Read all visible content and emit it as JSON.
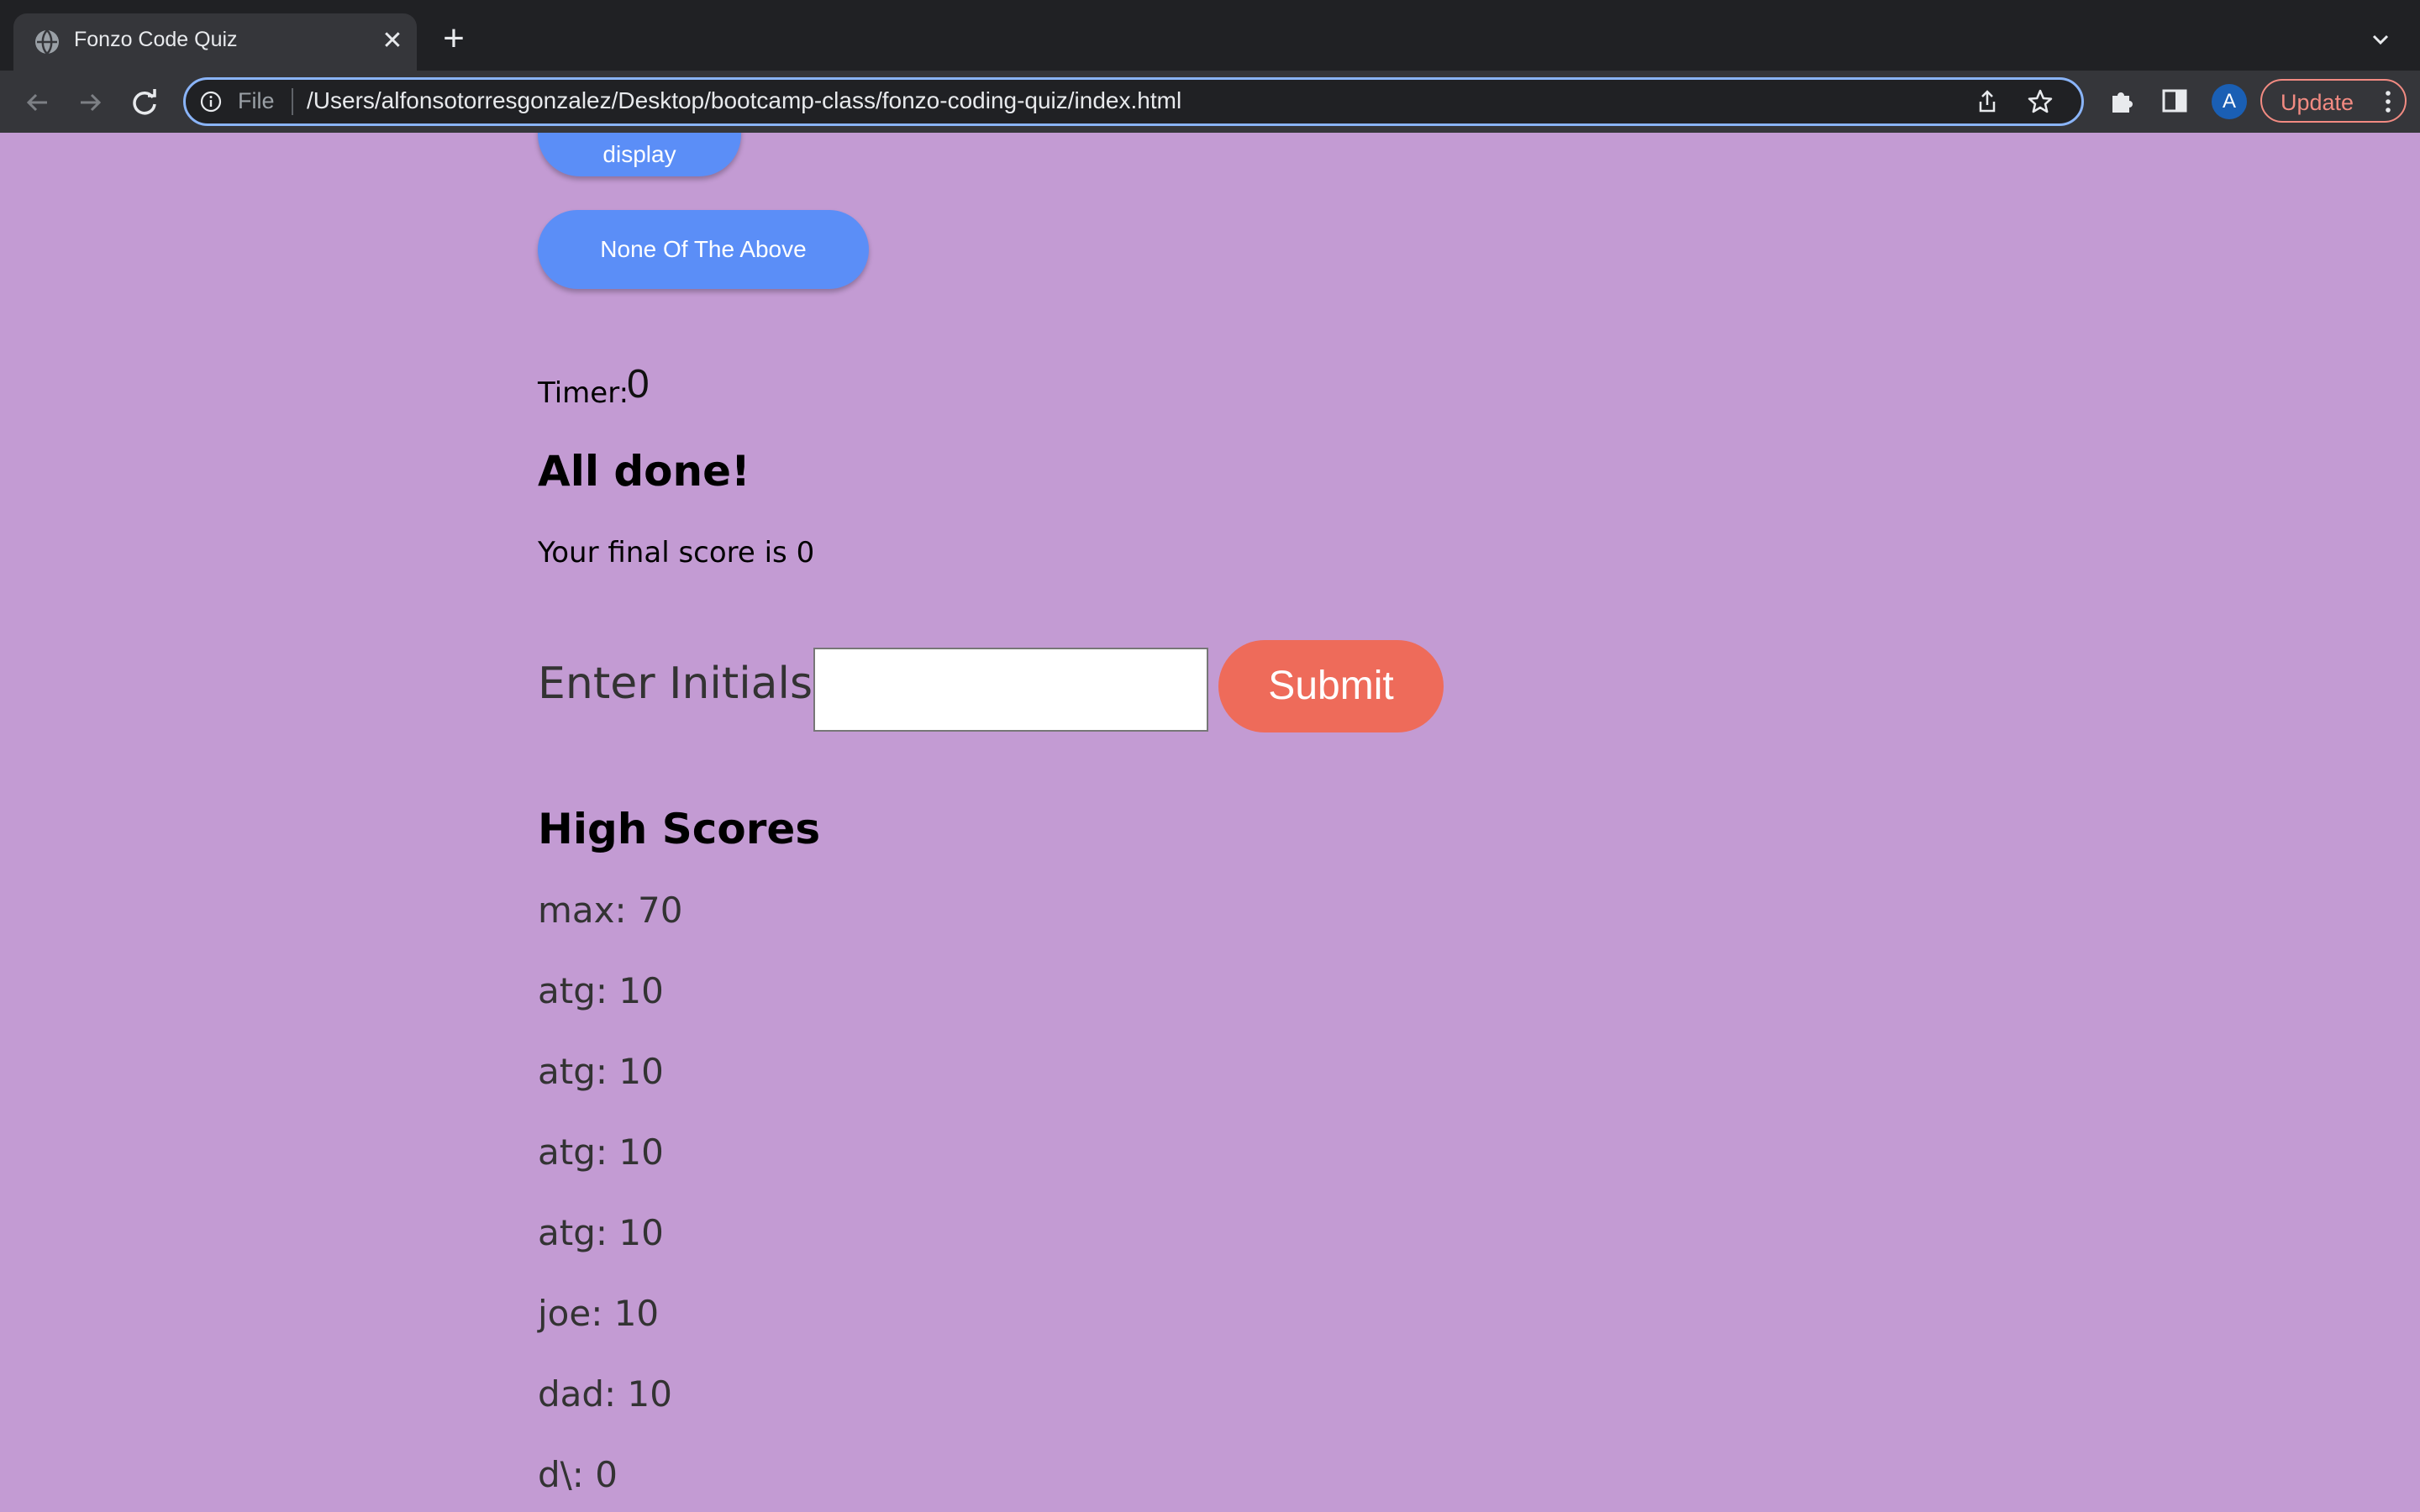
{
  "browser": {
    "tab_title": "Fonzo Code Quiz",
    "omnibox_scheme_label": "File",
    "url": "/Users/alfonsotorresgonzalez/Desktop/bootcamp-class/fonzo-coding-quiz/index.html",
    "avatar_letter": "A",
    "update_label": "Update",
    "icons": [
      "globe-icon",
      "close-icon",
      "plus-icon",
      "chevron-down-icon",
      "back-arrow-icon",
      "forward-arrow-icon",
      "reload-icon",
      "info-icon",
      "share-icon",
      "star-icon",
      "puzzle-icon",
      "side-panel-icon",
      "kebab-menu-icon"
    ]
  },
  "quiz": {
    "answer_partial_label": "display",
    "answer_none_label": "None Of The Above",
    "timer_label": "Timer:",
    "timer_value": "0",
    "done_heading": "All done!",
    "final_score_text": "Your final score is 0",
    "initials_label": "Enter Initials:",
    "initials_value": "",
    "submit_label": "Submit"
  },
  "high_scores": {
    "heading": "High Scores",
    "entries": [
      "max: 70",
      "atg: 10",
      "atg: 10",
      "atg: 10",
      "atg: 10",
      "joe: 10",
      "dad: 10",
      "d\\: 0"
    ]
  },
  "colors": {
    "page_background": "#c39bd3",
    "answer_button": "#5b8ef7",
    "submit_button": "#ee6b5a",
    "browser_frame": "#202124",
    "omnibox_focus": "#8ab4f8"
  }
}
